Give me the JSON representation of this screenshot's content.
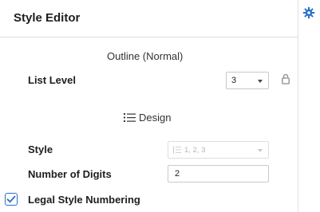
{
  "header": {
    "title": "Style Editor"
  },
  "side": {
    "icon": "gear-icon"
  },
  "outline": {
    "label": "Outline (Normal)"
  },
  "list_level": {
    "label": "List Level",
    "value": "3"
  },
  "design": {
    "label": "Design"
  },
  "style": {
    "label": "Style",
    "value": "1, 2, 3"
  },
  "digits": {
    "label": "Number of Digits",
    "value": "2"
  },
  "legal": {
    "label": "Legal Style Numbering",
    "checked": true
  },
  "colors": {
    "accent": "#2a6fca",
    "border": "#c9c9c9"
  }
}
